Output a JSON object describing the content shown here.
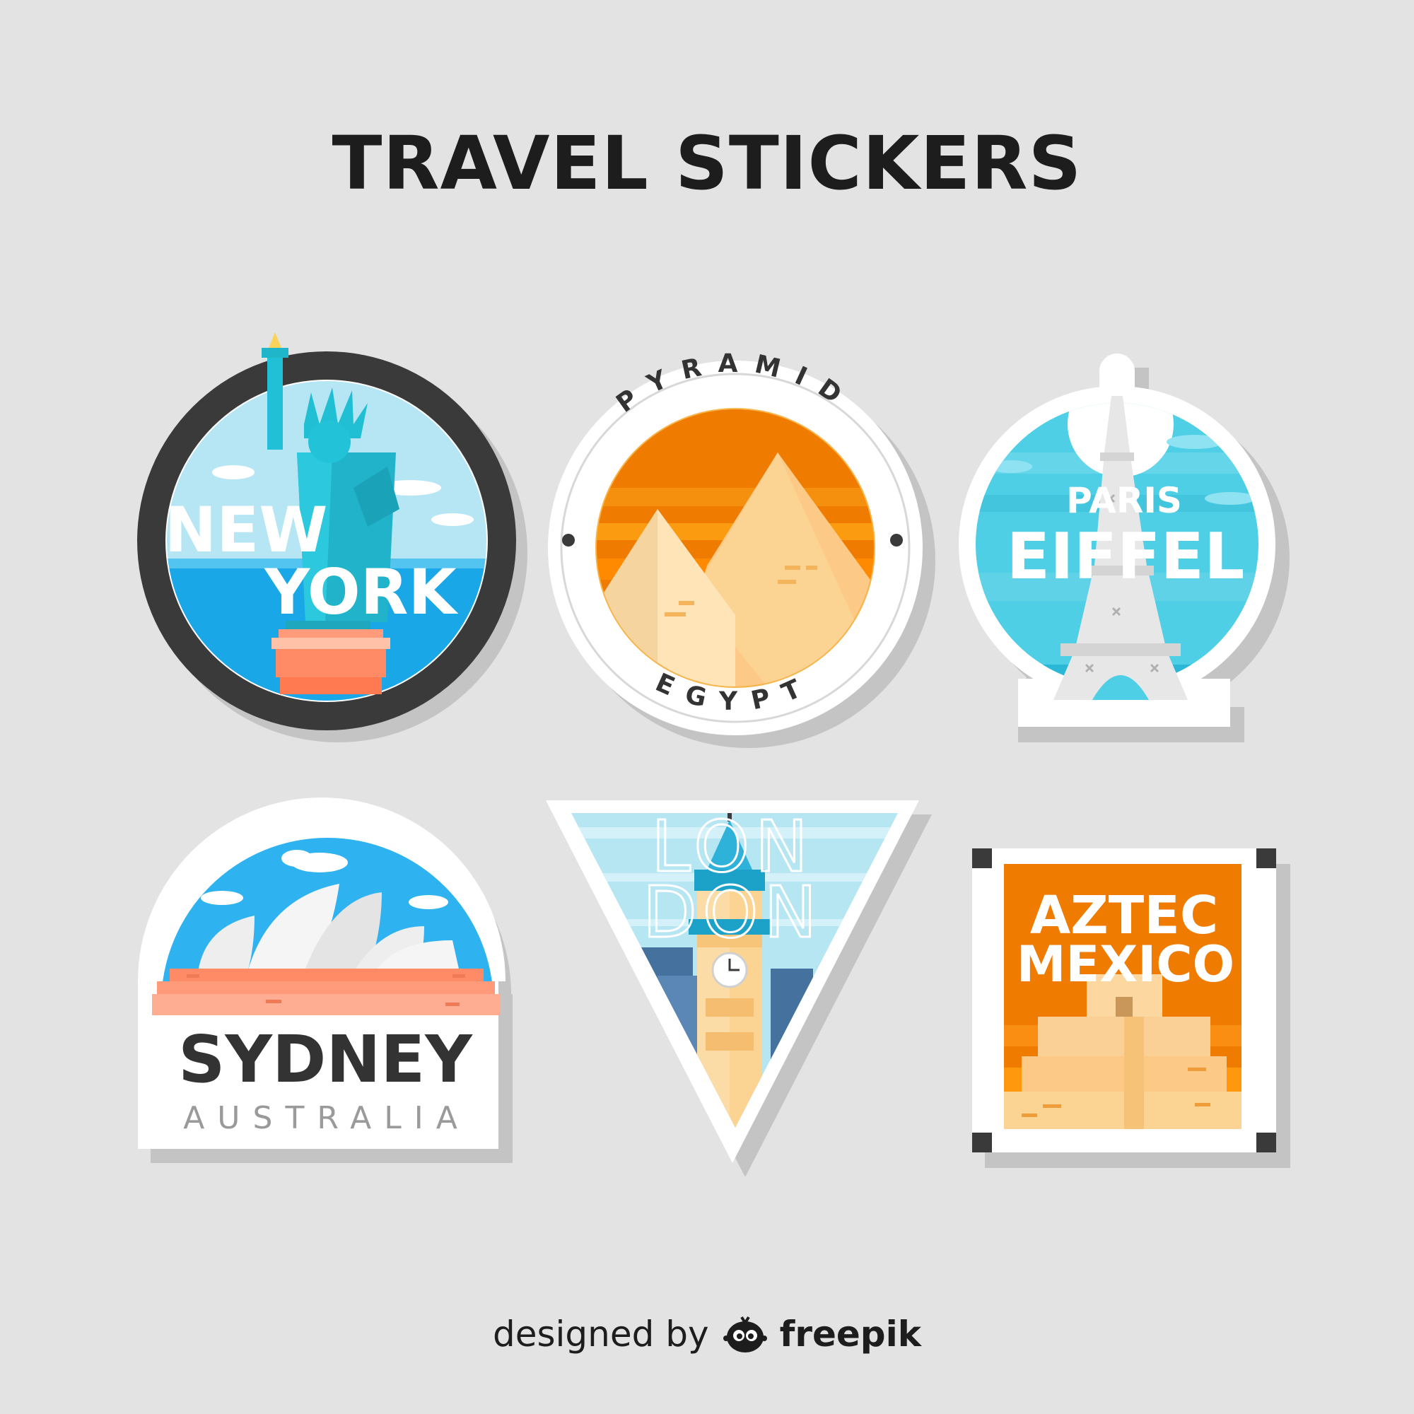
{
  "title": "TRAVEL STICKERS",
  "stickers": {
    "new_york": {
      "line1": "NEW",
      "line2": "YORK"
    },
    "egypt": {
      "top": "PYRAMID",
      "bottom": "EGYPT"
    },
    "paris": {
      "line1": "PARIS",
      "line2": "EIFFEL"
    },
    "sydney": {
      "line1": "SYDNEY",
      "line2": "AUSTRALIA"
    },
    "london": {
      "line1": "LON",
      "line2": "DON"
    },
    "mexico": {
      "line1": "AZTEC",
      "line2": "MEXICO"
    }
  },
  "credit": {
    "prefix": "designed by",
    "brand": "freepik"
  },
  "icons": [
    "statue-of-liberty-icon",
    "pyramids-icon",
    "eiffel-tower-icon",
    "sydney-opera-house-icon",
    "big-ben-icon",
    "aztec-pyramid-icon",
    "freepik-logo-icon"
  ],
  "colors": {
    "background": "#e3e3e3",
    "orange": "#ef7b00",
    "sky_blue": "#4fcfe6",
    "dark_ring": "#3a3a3a"
  }
}
